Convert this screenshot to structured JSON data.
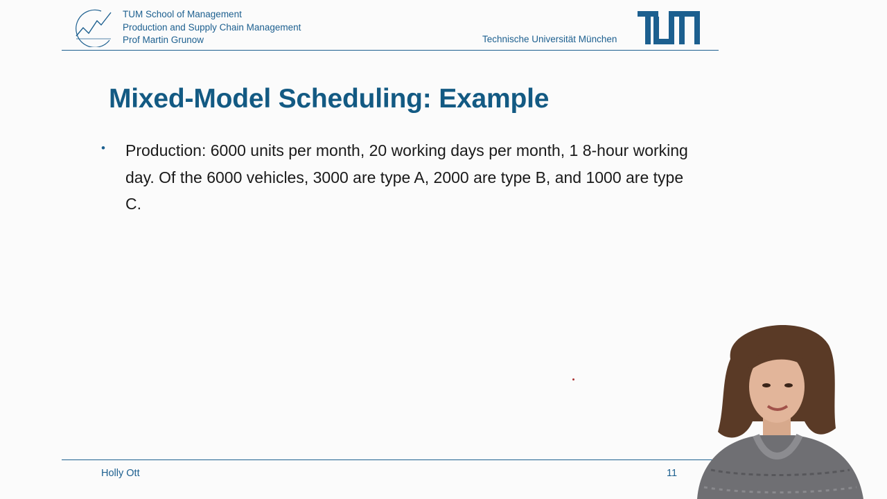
{
  "header": {
    "school": "TUM School of Management",
    "chair": "Production and Supply Chain Management",
    "professor": "Prof Martin Grunow",
    "university": "Technische Universität München",
    "brand_color": "#1c5f8f"
  },
  "slide": {
    "title": "Mixed-Model Scheduling: Example",
    "bullet_symbol": "•",
    "bullets": [
      "Production: 6000 units per month, 20 working days per month, 1 8-hour working day. Of the 6000 vehicles, 3000 are type A, 2000 are type B, and 1000 are type C."
    ]
  },
  "footer": {
    "author": "Holly Ott",
    "page_number": "11"
  },
  "icons": {
    "school_logo": "chart-line-logo-icon",
    "university_logo": "tum-logo-icon"
  }
}
